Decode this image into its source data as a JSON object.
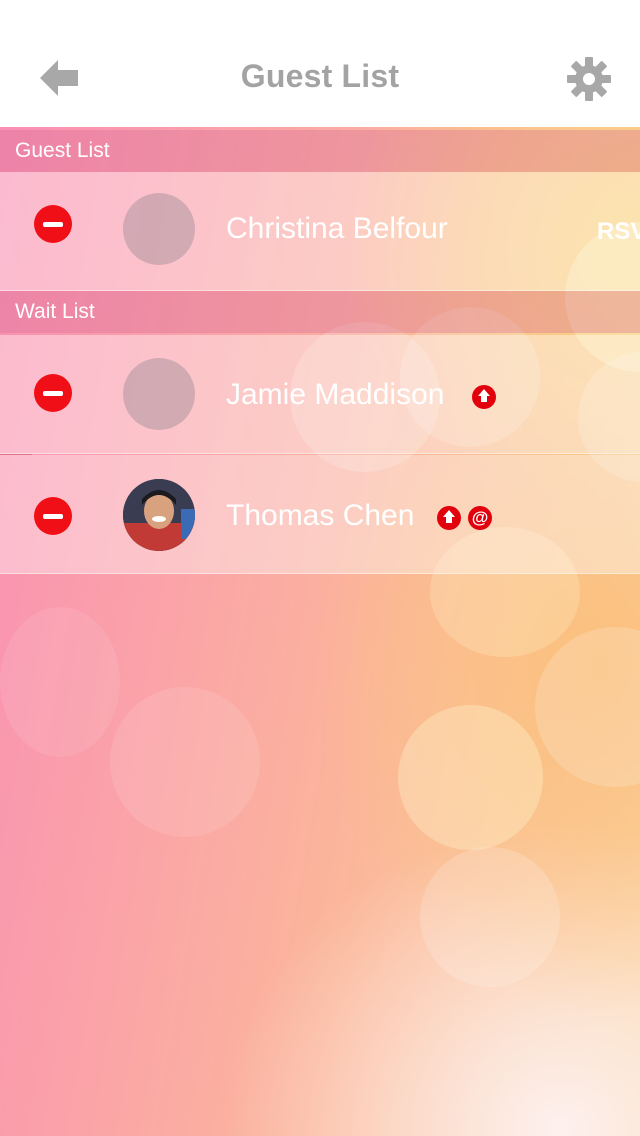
{
  "header": {
    "title": "Guest List",
    "back_icon": "back-arrow-icon",
    "settings_icon": "gear-icon"
  },
  "sections": {
    "guest_list": {
      "label": "Guest List",
      "rows": [
        {
          "name": "Christina Belfour",
          "status": "RSV",
          "avatar": "placeholder"
        }
      ]
    },
    "wait_list": {
      "label": "Wait List",
      "rows": [
        {
          "name": "Jamie Maddison",
          "badges": [
            "upgrade-icon"
          ],
          "avatar": "placeholder"
        },
        {
          "name": "Thomas Chen",
          "badges": [
            "upgrade-icon",
            "at-icon"
          ],
          "avatar": "photo",
          "at_symbol": "@"
        }
      ]
    }
  },
  "colors": {
    "header_bg": "#ffffff",
    "title": "#a3a3a3",
    "accent_red": "#f00f16",
    "section_bg": "#d66e96"
  }
}
